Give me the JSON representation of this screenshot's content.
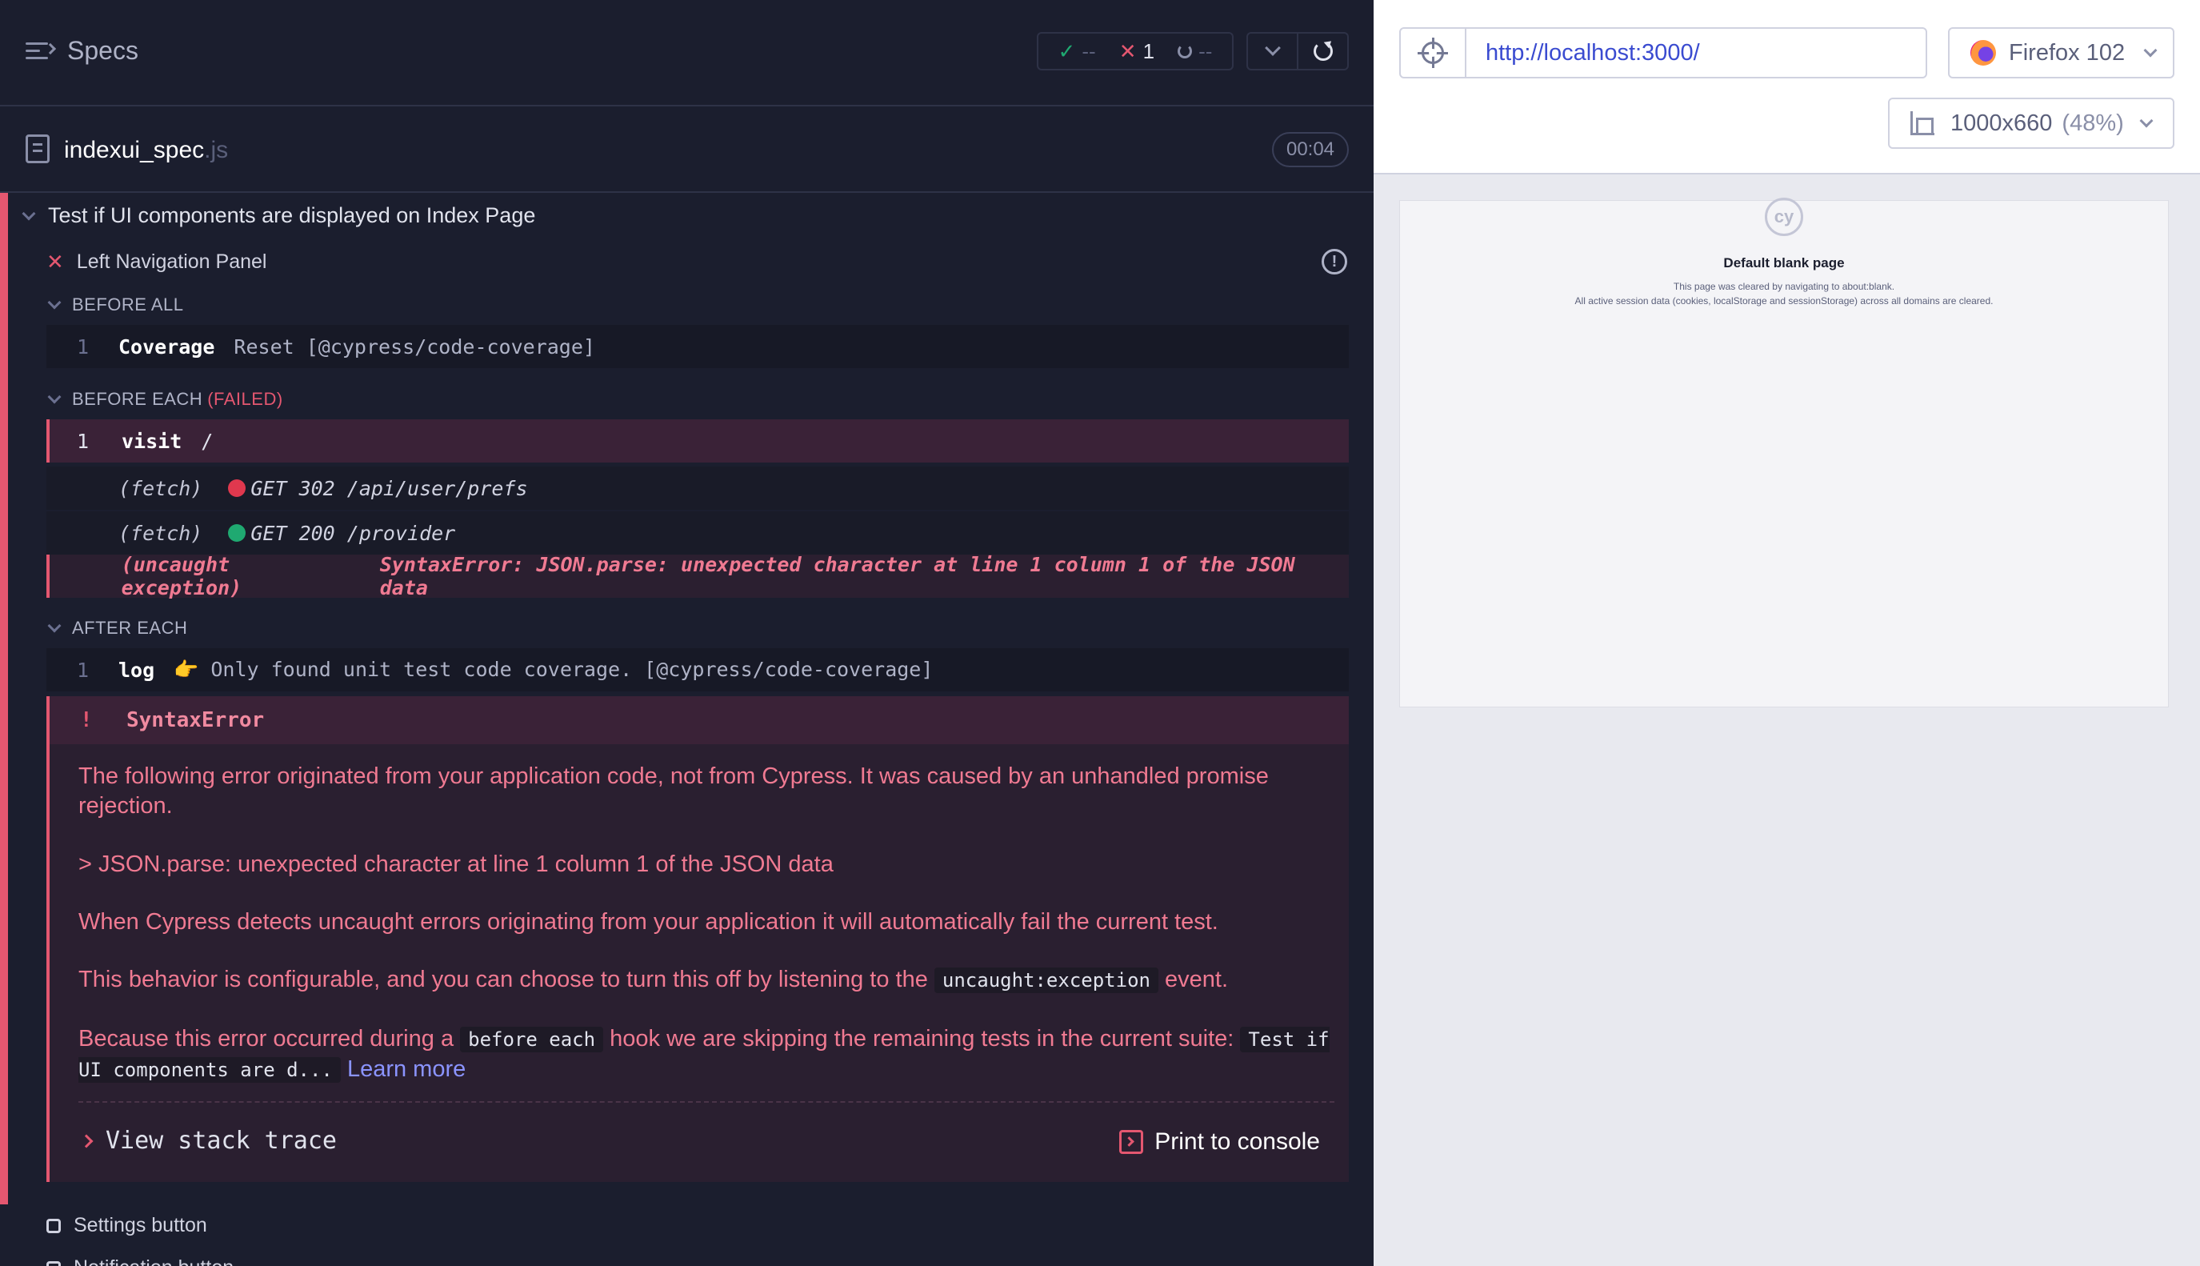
{
  "reporter": {
    "header": {
      "title": "Specs",
      "stats": {
        "passed": "--",
        "failed": "1",
        "pending": "--"
      }
    },
    "spec": {
      "name": "indexui_spec",
      "ext": ".js",
      "duration": "00:04"
    },
    "suite": {
      "title": "Test if UI components are displayed on Index Page",
      "test": {
        "title": "Left Navigation Panel",
        "hooks": {
          "before_all": {
            "label": "BEFORE ALL",
            "commands": [
              {
                "num": "1",
                "name": "Coverage",
                "message": "Reset [@cypress/code-coverage]"
              }
            ]
          },
          "before_each": {
            "label": "BEFORE EACH",
            "status": "(FAILED)",
            "commands": [
              {
                "num": "1",
                "name": "visit",
                "message": "/"
              },
              {
                "name": "(fetch)",
                "message": "GET 302 /api/user/prefs",
                "status_color": "#e0384e"
              },
              {
                "name": "(fetch)",
                "message": "GET 200 /provider",
                "status_color": "#1fa971"
              },
              {
                "name": "(uncaught exception)",
                "message": "SyntaxError: JSON.parse: unexpected character at line 1 column 1 of the JSON data"
              }
            ]
          },
          "after_each": {
            "label": "AFTER EACH",
            "commands": [
              {
                "num": "1",
                "name": "log",
                "message": "👉 Only found unit test code coverage. [@cypress/code-coverage]"
              }
            ]
          }
        },
        "error": {
          "marker": "!",
          "name": "SyntaxError",
          "p1": "The following error originated from your application code, not from Cypress. It was caused by an unhandled promise rejection.",
          "p2": "> JSON.parse: unexpected character at line 1 column 1 of the JSON data",
          "p3": "When Cypress detects uncaught errors originating from your application it will automatically fail the current test.",
          "p4_pre": "This behavior is configurable, and you can choose to turn this off by listening to the",
          "p4_code": "uncaught:exception",
          "p4_post": "event.",
          "p5_pre": "Because this error occurred during a",
          "p5_code": "before each",
          "p5_post": "hook we are skipping the remaining tests in the current suite:",
          "p5_suite": "Test if UI components are d...",
          "learn_more": "Learn more",
          "stack_trace": "View stack trace",
          "print_console": "Print to console"
        }
      },
      "pending_tests": [
        "Settings button",
        "Notification button"
      ]
    }
  },
  "aut": {
    "url": "http://localhost:3000/",
    "browser": "Firefox 102",
    "viewport": "1000x660",
    "scale": "(48%)",
    "blank_page": {
      "logo": "cy",
      "title": "Default blank page",
      "line1": "This page was cleared by navigating to about:blank.",
      "line2": "All active session data (cookies, localStorage and sessionStorage) across all domains are cleared."
    }
  },
  "colors": {
    "background": "#1b1e2e",
    "failed": "#e45770",
    "passed": "#1fa971",
    "link": "#8b94ff"
  }
}
